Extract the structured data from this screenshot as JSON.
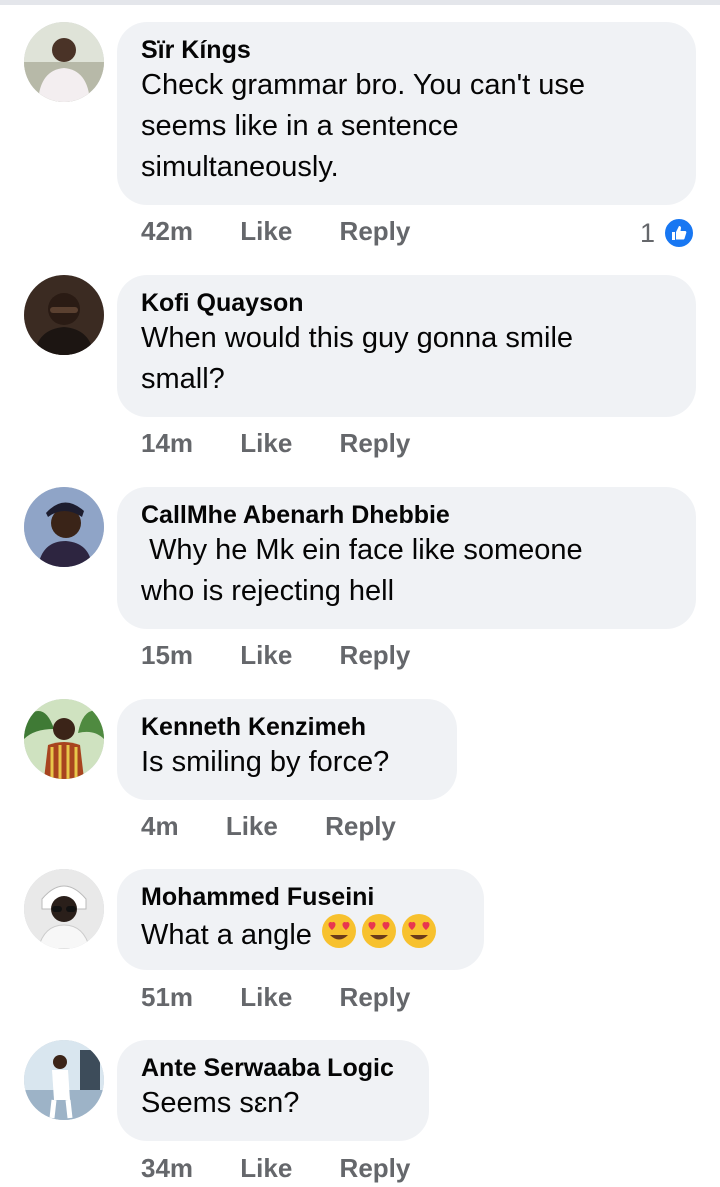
{
  "comments": [
    {
      "author": "Sïr Kíngs",
      "text": "Check grammar bro. You can't use\nseems like in a sentence\nsimultaneously.",
      "time": "42m",
      "like_label": "Like",
      "reply_label": "Reply",
      "reaction_count": "1",
      "avatar_icon": "profile-photo"
    },
    {
      "author": "Kofi Quayson",
      "text": "When would this guy gonna smile\nsmall?",
      "time": "14m",
      "like_label": "Like",
      "reply_label": "Reply",
      "avatar_icon": "profile-photo"
    },
    {
      "author": "CallMhe Abenarh Dhebbie",
      "text": " Why he Mk ein face like someone\nwho is rejecting hell",
      "time": "15m",
      "like_label": "Like",
      "reply_label": "Reply",
      "avatar_icon": "profile-photo"
    },
    {
      "author": "Kenneth Kenzimeh",
      "text": "Is smiling by force?",
      "time": "4m",
      "like_label": "Like",
      "reply_label": "Reply",
      "avatar_icon": "profile-photo"
    },
    {
      "author": "Mohammed Fuseini",
      "text": "What a angle ",
      "emoji": [
        "heart-eyes-emoji",
        "heart-eyes-emoji",
        "heart-eyes-emoji"
      ],
      "time": "51m",
      "like_label": "Like",
      "reply_label": "Reply",
      "avatar_icon": "profile-photo"
    },
    {
      "author": "Ante Serwaaba Logic",
      "text": "Seems sɛn?",
      "time": "34m",
      "like_label": "Like",
      "reply_label": "Reply",
      "avatar_icon": "profile-photo"
    }
  ],
  "colors": {
    "bubble": "#f0f2f5",
    "secondary_text": "#65676b",
    "like_blue": "#1877f2"
  }
}
